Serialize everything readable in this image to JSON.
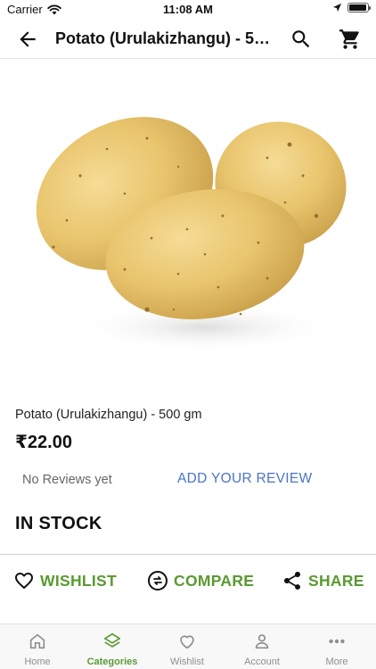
{
  "status_bar": {
    "carrier": "Carrier",
    "time": "11:08 AM",
    "battery_level": 0.95
  },
  "nav": {
    "title": "Potato (Urulakizhangu) - 500...",
    "icons": [
      "back-arrow-icon",
      "search-icon",
      "cart-icon"
    ]
  },
  "product": {
    "name": "Potato (Urulakizhangu) - 500 gm",
    "price": "₹22.00",
    "reviews_text": "No Reviews yet",
    "add_review_label": "ADD YOUR REVIEW",
    "stock_status": "IN STOCK"
  },
  "actions": {
    "wishlist_label": "WISHLIST",
    "compare_label": "COMPARE",
    "share_label": "SHARE",
    "accent_color": "#5a9a32"
  },
  "tab_bar": {
    "active": "Categories",
    "items": [
      {
        "label": "Home",
        "icon": "home-icon"
      },
      {
        "label": "Categories",
        "icon": "layers-icon"
      },
      {
        "label": "Wishlist",
        "icon": "heart-icon"
      },
      {
        "label": "Account",
        "icon": "person-icon"
      },
      {
        "label": "More",
        "icon": "more-dots-icon"
      }
    ]
  },
  "colors": {
    "accent_green": "#5a9a32",
    "link_blue": "#4a74c9"
  }
}
